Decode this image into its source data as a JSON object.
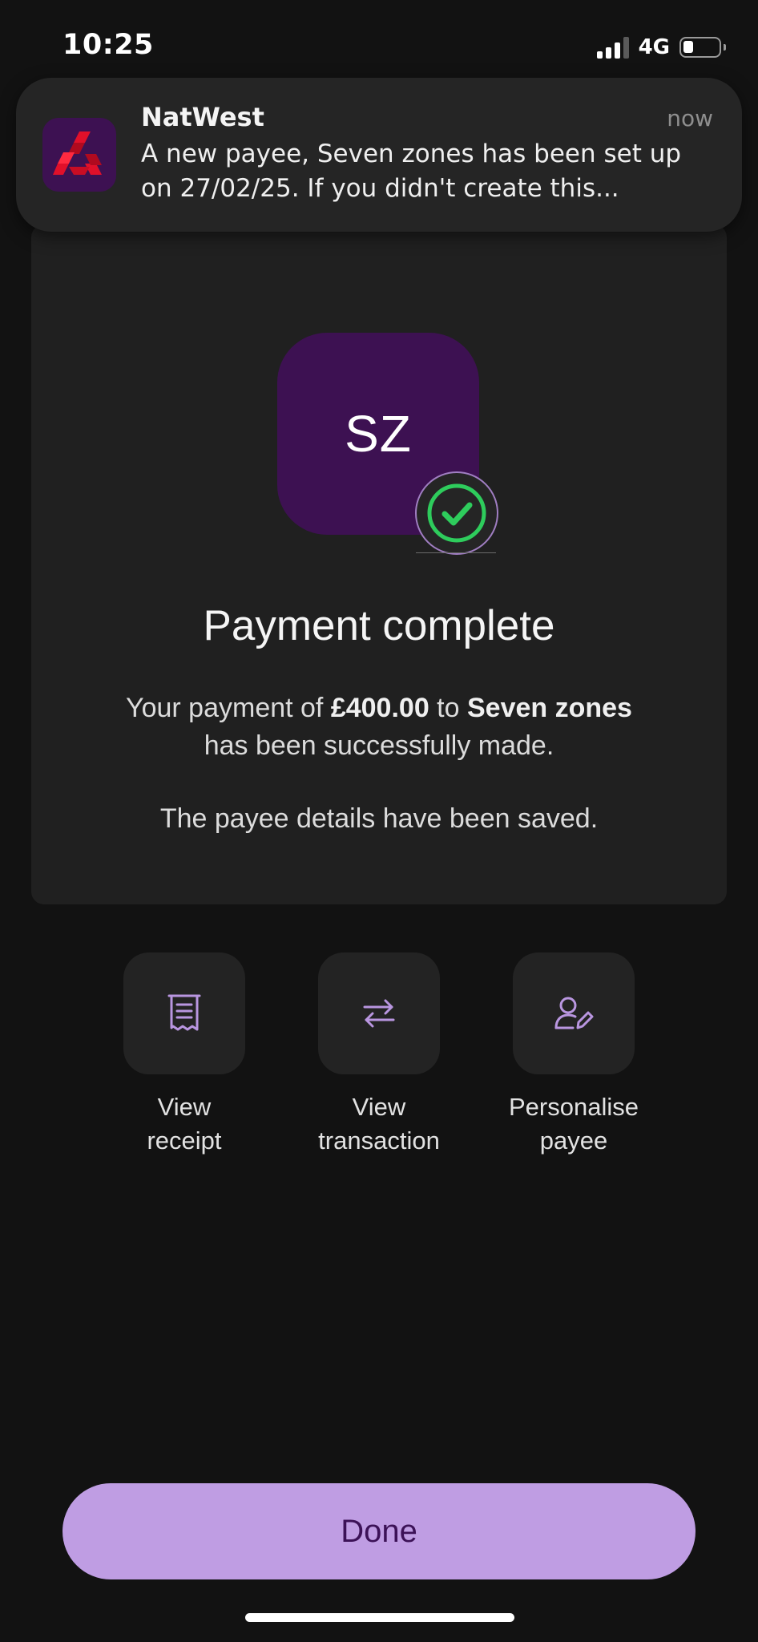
{
  "status_bar": {
    "time": "10:25",
    "network": "4G"
  },
  "notification": {
    "app_name": "NatWest",
    "time": "now",
    "message": "A new payee, Seven zones has been set up on 27/02/25. If you didn't create this..."
  },
  "payment": {
    "payee_initials": "SZ",
    "title": "Payment complete",
    "message_prefix": "Your payment of ",
    "amount": "£400.00",
    "message_mid": " to ",
    "payee_name": "Seven zones",
    "message_line2": "has been successfully made.",
    "note": "The payee details have been saved."
  },
  "actions": [
    {
      "line1": "View",
      "line2": "receipt",
      "icon": "receipt-icon"
    },
    {
      "line1": "View",
      "line2": "transaction",
      "icon": "transfer-arrows-icon"
    },
    {
      "line1": "Personalise",
      "line2": "payee",
      "icon": "user-edit-icon"
    }
  ],
  "done_label": "Done",
  "colors": {
    "background": "#121212",
    "card": "#202020",
    "brand_purple": "#3d1152",
    "accent_lilac": "#bf9de3",
    "success_green": "#2ecc5c",
    "natwest_red": "#e0102a"
  }
}
